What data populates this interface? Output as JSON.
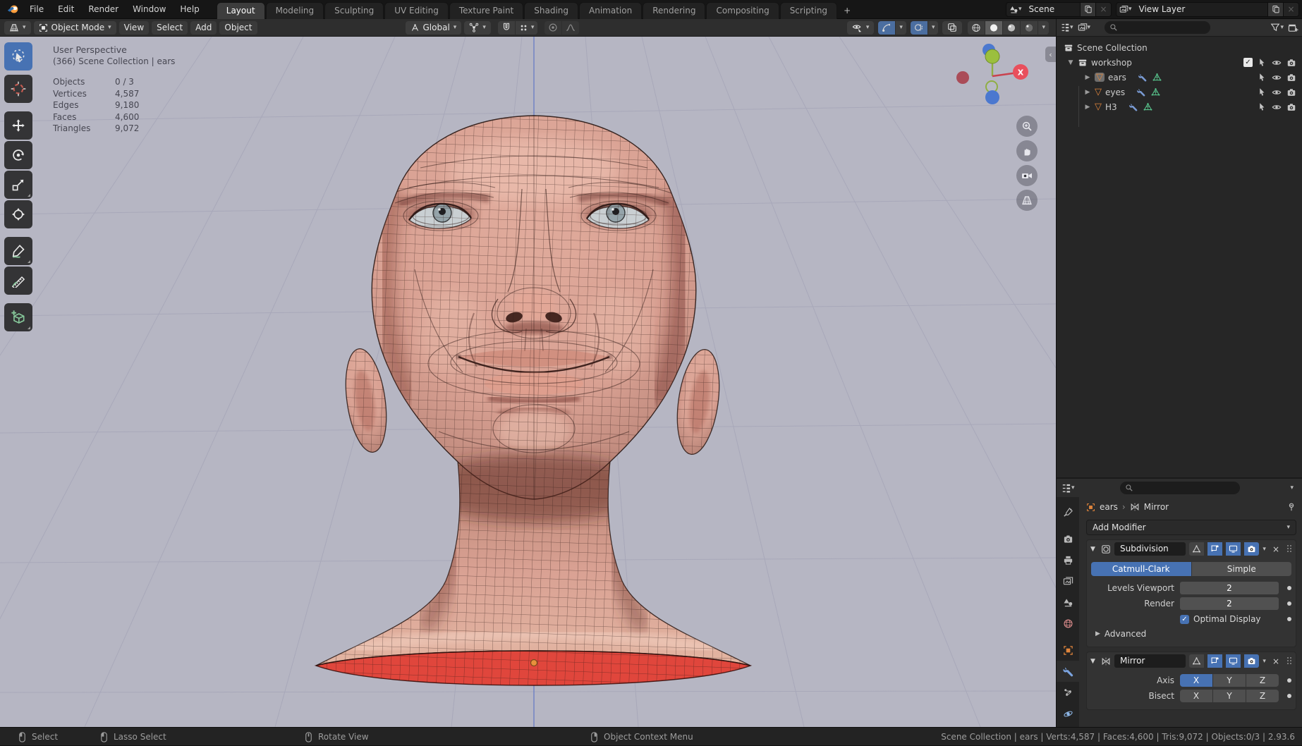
{
  "colors": {
    "accent": "#4772b3",
    "viewport_bg": "#b6b6c3",
    "skin": "#d9a193",
    "skin_shadow": "#a9766a",
    "select_red": "#e0463c",
    "axis_blue": "#7083c4",
    "mesh_orange": "#e0853c",
    "addon_green": "#74c18e"
  },
  "topbar": {
    "menus": [
      "File",
      "Edit",
      "Render",
      "Window",
      "Help"
    ],
    "tabs": [
      "Layout",
      "Modeling",
      "Sculpting",
      "UV Editing",
      "Texture Paint",
      "Shading",
      "Animation",
      "Rendering",
      "Compositing",
      "Scripting"
    ],
    "new_tab": "+",
    "scene": {
      "label": "Scene"
    },
    "view_layer": {
      "label": "View Layer"
    }
  },
  "viewport_header": {
    "mode": "Object Mode",
    "menus": [
      "View",
      "Select",
      "Add",
      "Object"
    ],
    "orientation": "Global"
  },
  "viewport": {
    "view_label": "User Perspective",
    "context_label": "(366) Scene Collection | ears",
    "stats": [
      {
        "label": "Objects",
        "value": "0 / 3"
      },
      {
        "label": "Vertices",
        "value": "4,587"
      },
      {
        "label": "Edges",
        "value": "9,180"
      },
      {
        "label": "Faces",
        "value": "4,600"
      },
      {
        "label": "Triangles",
        "value": "9,072"
      }
    ],
    "gizmo_x_label": "X"
  },
  "outliner": {
    "root": "Scene Collection",
    "collection": "workshop",
    "items": [
      {
        "name": "ears"
      },
      {
        "name": "eyes"
      },
      {
        "name": "H3"
      }
    ]
  },
  "properties": {
    "breadcrumb": {
      "object": "ears",
      "separator": "›",
      "modifier": "Mirror"
    },
    "add_modifier": "Add Modifier",
    "subdivision": {
      "name": "Subdivision",
      "type_options": [
        "Catmull-Clark",
        "Simple"
      ],
      "levels_label": "Levels Viewport",
      "levels_value": "2",
      "render_label": "Render",
      "render_value": "2",
      "optimal_display": "Optimal Display",
      "advanced": "Advanced"
    },
    "mirror": {
      "name": "Mirror",
      "axis_label": "Axis",
      "bisect_label": "Bisect",
      "axis_options": [
        "X",
        "Y",
        "Z"
      ]
    }
  },
  "statusbar": {
    "hints": [
      {
        "label": "Select"
      },
      {
        "label": "Lasso Select"
      },
      {
        "label": "Rotate View"
      },
      {
        "label": "Object Context Menu"
      }
    ],
    "info": "Scene Collection | ears | Verts:4,587 | Faces:4,600 | Tris:9,072 | Objects:0/3 | 2.93.6"
  }
}
